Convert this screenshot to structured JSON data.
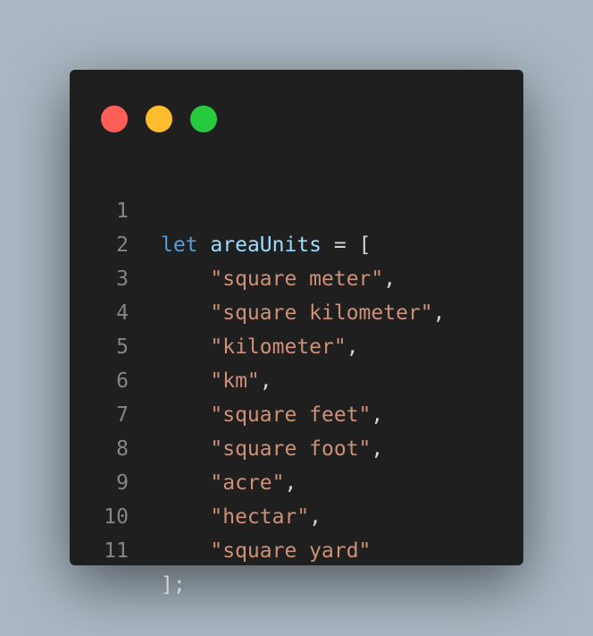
{
  "window": {
    "controls": [
      {
        "name": "close",
        "color": "#ff5f56"
      },
      {
        "name": "minimize",
        "color": "#ffbd2e"
      },
      {
        "name": "maximize",
        "color": "#27c93f"
      }
    ]
  },
  "code": {
    "lines": [
      {
        "n": "1",
        "keyword": "let",
        "ident": "areaUnits",
        "op": "=",
        "open": "["
      },
      {
        "n": "2",
        "indent": "    ",
        "string": "\"square meter\"",
        "tail": ","
      },
      {
        "n": "3",
        "indent": "    ",
        "string": "\"square kilometer\"",
        "tail": ","
      },
      {
        "n": "4",
        "indent": "    ",
        "string": "\"kilometer\"",
        "tail": ","
      },
      {
        "n": "5",
        "indent": "    ",
        "string": "\"km\"",
        "tail": ","
      },
      {
        "n": "6",
        "indent": "    ",
        "string": "\"square feet\"",
        "tail": ","
      },
      {
        "n": "7",
        "indent": "    ",
        "string": "\"square foot\"",
        "tail": ","
      },
      {
        "n": "8",
        "indent": "    ",
        "string": "\"acre\"",
        "tail": ","
      },
      {
        "n": "9",
        "indent": "    ",
        "string": "\"hectar\"",
        "tail": ","
      },
      {
        "n": "10",
        "indent": "    ",
        "string": "\"square yard\"",
        "tail": ""
      },
      {
        "n": "11",
        "close": "];"
      }
    ]
  },
  "colors": {
    "background": "#abb8c3",
    "window": "#1f1f1f",
    "keyword": "#569cd6",
    "identifier": "#9cdcfe",
    "string": "#ce9178",
    "punctuation": "#d4d4d4",
    "line_number": "#858585"
  }
}
